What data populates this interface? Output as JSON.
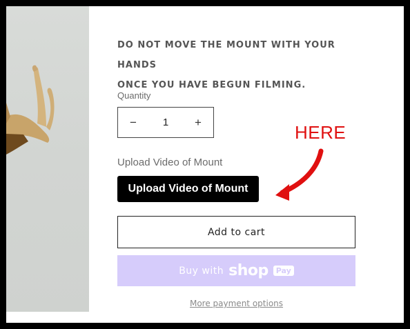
{
  "product": {
    "warning_line1": "DO NOT MOVE THE MOUNT WITH YOUR HANDS",
    "warning_line2": "ONCE YOU HAVE BEGUN FILMING."
  },
  "quantity": {
    "label": "Quantity",
    "value": "1",
    "decrement_icon": "−",
    "increment_icon": "+"
  },
  "upload": {
    "label": "Upload Video of Mount",
    "button_label": "Upload Video of Mount"
  },
  "annotation": {
    "text": "HERE",
    "color": "#e01010"
  },
  "cart": {
    "add_to_cart_label": "Add to cart"
  },
  "shop_pay": {
    "prefix": "Buy with",
    "brand": "shop",
    "badge": "Pay",
    "background": "#d6ccfb"
  },
  "more_payment_options": "More payment options"
}
